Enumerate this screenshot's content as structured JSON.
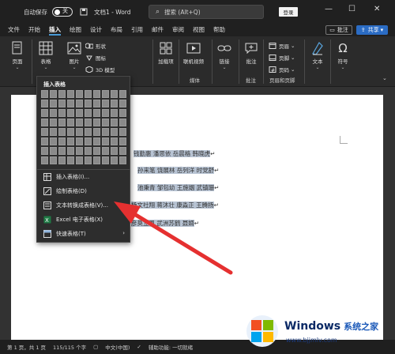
{
  "titlebar": {
    "autosave_label": "自动保存",
    "autosave_state": "关",
    "doc_title": "文档1 - Word",
    "search_placeholder": "搜索 (Alt+Q)",
    "login_label": "登录"
  },
  "tabs": [
    "文件",
    "开始",
    "插入",
    "绘图",
    "设计",
    "布局",
    "引用",
    "邮件",
    "审阅",
    "视图",
    "帮助"
  ],
  "active_tab": "插入",
  "top_right": {
    "comment_label": "批注",
    "share_label": "共享"
  },
  "ribbon": {
    "pages_label": "页面",
    "table_label": "表格",
    "picture_label": "图片",
    "shapes_label": "形状",
    "icons_label": "图标",
    "models_label": "3D 模型",
    "addins_label": "加载项",
    "online_video_label": "联机视频",
    "media_group_label": "媒体",
    "link_label": "链接",
    "comment_label": "批注",
    "comment_group_label": "批注",
    "header_label": "页眉",
    "footer_label": "页脚",
    "page_number_label": "页码",
    "header_footer_group_label": "页眉和页脚",
    "text_label": "文本",
    "symbol_label": "符号"
  },
  "insert_table_menu": {
    "title": "插入表格",
    "grid_cols": 10,
    "grid_rows": 8,
    "items": [
      {
        "label": "插入表格(I)...",
        "icon": "table-icon"
      },
      {
        "label": "绘制表格(D)",
        "icon": "pencil-table-icon"
      },
      {
        "label": "文本转换成表格(V)...",
        "icon": "text-to-table-icon"
      },
      {
        "label": "Excel 电子表格(X)",
        "icon": "excel-icon"
      },
      {
        "label": "快速表格(T)",
        "icon": "quick-table-icon"
      }
    ]
  },
  "document": {
    "lines": [
      "钱勤惠  潘思依  岳晨格  韩晓虎",
      "孙来笔  饶展林  岳列洋  时党舒",
      "池秉青  邹包幼  王施姻  武镇珊",
      "文社翔  蒋沐壮  康淼正  王腾扬",
      "莫立恩  武洲苏鹤  聂婿"
    ],
    "line_prefixes": [
      "",
      "",
      "",
      "杨",
      "彦"
    ]
  },
  "statusbar": {
    "page": "第 1 页，共 1 页",
    "words": "115/115 个字",
    "language": "中文(中国)",
    "accessibility": "辅助功能: 一切就绪"
  },
  "watermark": {
    "brand": "Windows",
    "brand_cn": "系统之家",
    "url": "www.bjjmlv.com"
  },
  "colors": {
    "accent": "#4a9bd6",
    "share_button": "#2b6cc4",
    "arrow": "#e53030",
    "selection_highlight": "#b7c3d3"
  }
}
